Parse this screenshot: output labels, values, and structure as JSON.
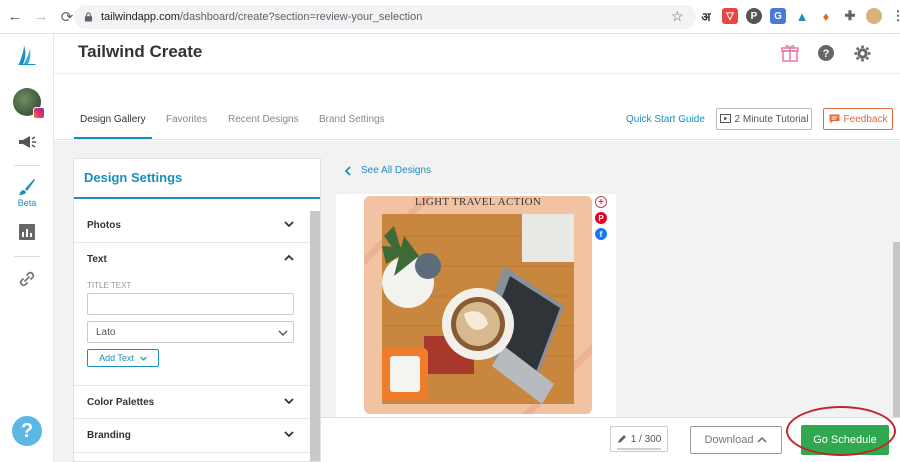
{
  "browser": {
    "url_host": "tailwindapp.com",
    "url_path": "/dashboard/create?section=review-your_selection",
    "ext_icons": [
      "hindi-icon",
      "pocket-icon",
      "pinterest-icon",
      "translate-icon",
      "tailwind-ext-icon",
      "flag-icon",
      "puzzle-icon",
      "profile-icon",
      "menu-icon"
    ]
  },
  "header": {
    "title": "Tailwind Create"
  },
  "tabs": [
    {
      "label": "Design Gallery",
      "active": true
    },
    {
      "label": "Favorites",
      "active": false
    },
    {
      "label": "Recent Designs",
      "active": false
    },
    {
      "label": "Brand Settings",
      "active": false
    }
  ],
  "toolbar": {
    "quick_start": "Quick Start Guide",
    "tutorial": "2 Minute Tutorial",
    "feedback": "Feedback"
  },
  "sidebar": {
    "beta_label": "Beta",
    "help_symbol": "?"
  },
  "settings": {
    "title": "Design Settings",
    "sections": {
      "photos": "Photos",
      "text": "Text",
      "color_palettes": "Color Palettes",
      "branding": "Branding"
    },
    "title_text_label": "TITLE TEXT",
    "title_text_value": "",
    "font_value": "Lato",
    "add_text": "Add Text"
  },
  "canvas": {
    "see_all": "See All Designs",
    "design_heading": "LIGHT TRAVEL ACTION"
  },
  "bottom": {
    "counter": "1 / 300",
    "download": "Download",
    "schedule": "Go Schedule"
  },
  "colors": {
    "accent": "#1a8fbf",
    "feedback": "#e06a3a",
    "schedule": "#2fa84f",
    "annotation": "#c0282e"
  }
}
